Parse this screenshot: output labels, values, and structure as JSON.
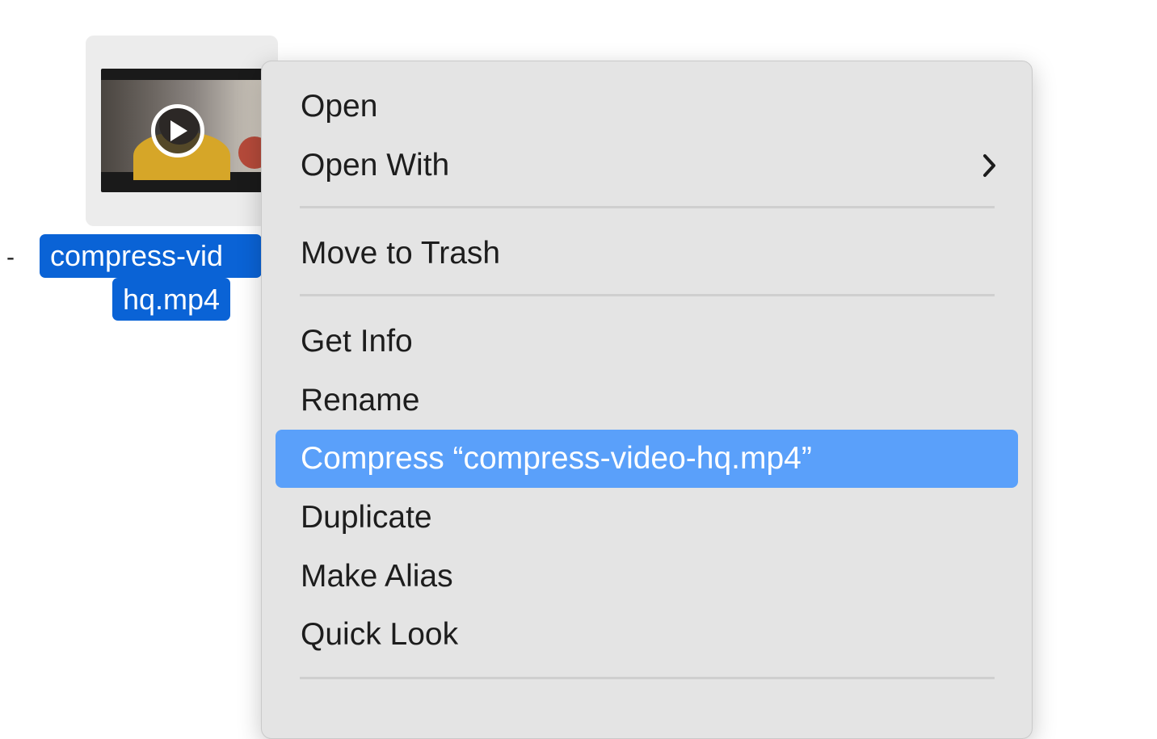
{
  "stray_text": "-",
  "file": {
    "name_line1": "compress-vid",
    "name_line2": "hq.mp4"
  },
  "icons": {
    "play": "play-icon",
    "submenu": "chevron-right-icon"
  },
  "colors": {
    "selection_blue": "#0a63d6",
    "menu_highlight": "#5aa0fa",
    "menu_background": "#e4e4e4"
  },
  "menu": {
    "open": "Open",
    "open_with": "Open With",
    "move_to_trash": "Move to Trash",
    "get_info": "Get Info",
    "rename": "Rename",
    "compress": "Compress “compress-video-hq.mp4”",
    "duplicate": "Duplicate",
    "make_alias": "Make Alias",
    "quick_look": "Quick Look"
  }
}
